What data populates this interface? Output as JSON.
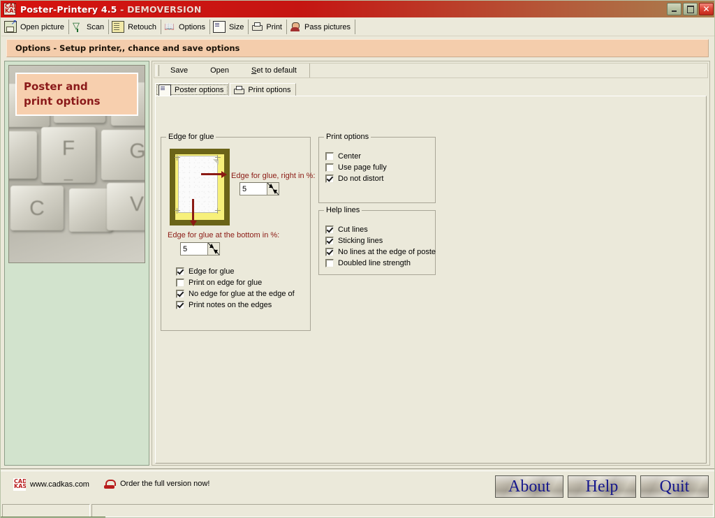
{
  "window": {
    "title_main": "Poster-Printery 4.5",
    "title_sep": " - ",
    "title_demo": "DEMOVERSION",
    "icon": "cadkas-app-icon",
    "buttons": {
      "minimize": "minimize-icon",
      "restore": "restore-icon",
      "close": "close-icon"
    }
  },
  "toolbar": {
    "items": [
      {
        "label": "Open picture",
        "icon": "open-picture-icon"
      },
      {
        "label": "Scan",
        "icon": "scanner-icon"
      },
      {
        "label": "Retouch",
        "icon": "retouch-icon"
      },
      {
        "label": "Options",
        "icon": "book-options-icon"
      },
      {
        "label": "Size",
        "icon": "size-icon"
      },
      {
        "label": "Print",
        "icon": "printer-icon"
      },
      {
        "label": "Pass pictures",
        "icon": "person-icon"
      }
    ]
  },
  "banner": {
    "text": "Options - Setup printer,, chance and save options"
  },
  "left_panel": {
    "promo_line1": "Poster and",
    "promo_line2": "print options",
    "photo_keys": [
      "F",
      "G",
      "C",
      "V"
    ]
  },
  "content": {
    "save_bar": {
      "save": "Save",
      "open": "Open",
      "set_default_prefix": "S",
      "set_default_rest": "et to default"
    },
    "tabs": [
      {
        "label": "Poster options",
        "icon": "poster-options-icon",
        "active": true
      },
      {
        "label": "Print options",
        "icon": "printer-icon",
        "active": false
      }
    ],
    "edge_group": {
      "title": "Edge for glue",
      "label_right": "Edge for glue, right in %:",
      "value_right": "5",
      "label_bottom": "Edge for glue at the bottom in %:",
      "value_bottom": "5",
      "checkboxes": [
        {
          "label": "Edge for glue",
          "checked": true
        },
        {
          "label": "Print on edge for glue",
          "checked": false
        },
        {
          "label": "No edge for glue at the edge of",
          "checked": true
        },
        {
          "label": "Print notes on the edges",
          "checked": true
        }
      ]
    },
    "print_group": {
      "title": "Print options",
      "checkboxes": [
        {
          "label": "Center",
          "checked": false
        },
        {
          "label": "Use page fully",
          "checked": false
        },
        {
          "label": "Do not distort",
          "checked": true
        }
      ]
    },
    "help_group": {
      "title": "Help lines",
      "checkboxes": [
        {
          "label": "Cut lines",
          "checked": true
        },
        {
          "label": "Sticking lines",
          "checked": true
        },
        {
          "label": "No lines at the edge of poste",
          "checked": true
        },
        {
          "label": "Doubled line strength",
          "checked": false
        }
      ]
    }
  },
  "ad_bar": {
    "website": "www.cadkas.com",
    "website_icon": "cadkas-logo-icon",
    "order": "Order the full version now!",
    "order_icon": "phone-icon",
    "buttons": {
      "about": "About",
      "help": "Help",
      "quit": "Quit"
    }
  },
  "statusbar": {
    "panel1": "",
    "panel2": ""
  },
  "colors": {
    "titlebar_red": "#d61410",
    "banner_peach": "#f4cdac",
    "panel_bg": "#ebe9da",
    "left_panel_green": "#d2e3cd",
    "accent_dark_red": "#8b1a14",
    "button_text_navy": "#16188c",
    "poster_frame_olive": "#6b6418",
    "poster_yellow": "#f7f07a",
    "status_accent_green": "#5f7a46"
  }
}
